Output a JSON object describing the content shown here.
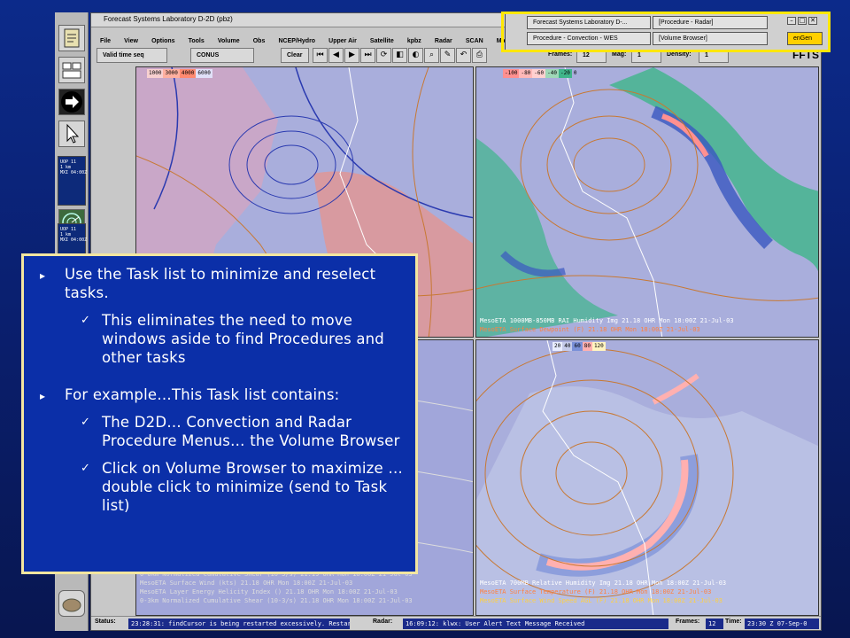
{
  "app": {
    "title": "Forecast Systems Laboratory D-2D (pbz)",
    "menu": [
      "File",
      "View",
      "Options",
      "Tools",
      "Volume",
      "Obs",
      "NCEP/Hydro",
      "Upper Air",
      "Satellite",
      "kpbz",
      "Radar",
      "SCAN",
      "Maps"
    ],
    "toolbar": {
      "time_mode": "Valid time seq",
      "scale": "CONUS",
      "clear": "Clear",
      "frames_label": "Frames:",
      "frames_value": "12",
      "mag_label": "Mag:",
      "mag_value": "1",
      "density_label": "Density:",
      "density_value": "1",
      "logo": "FFTS"
    }
  },
  "tasklist": {
    "items": [
      "Forecast Systems Laboratory D-...",
      "[Procedure - Radar]",
      "Procedure - Convection - WES",
      "[Volume Browser]"
    ],
    "extra_button": "enGen"
  },
  "panels": {
    "top_left_colorbar": [
      "1000",
      "3000",
      "4000",
      "6000"
    ],
    "top_right_colorbar": [
      "-100",
      "-80",
      "-60",
      "-40",
      "-20",
      "0"
    ],
    "bottom_right_colorbar": [
      "20",
      "40",
      "60",
      "80",
      "120"
    ],
    "top_right_legend": [
      "MesoETA 1000MB-850MB RAI Humidity Img  21.18   OHR Mon 18:00Z 21-Jul-03",
      "MesoETA Surface Dewpoint (F)  21.18   OHR Mon 18:00Z 21-Jul-03"
    ],
    "bottom_right_legend": [
      "MesoETA 700MB Relative Humidity Img  21.18   OHR Mon 18:00Z 21-Jul-03",
      "MesoETA Surface Temperature (F)  21.18   OHR Mon 18:00Z 21-Jul-03",
      "MesoETA Surface Wind Speed AGL (F)  21.18   OHR Mon 18:00Z 21-Jul-03"
    ],
    "bottom_left_legend": [
      "0-6km Normalized Cumulative Shear (10-3/s)  21.19   OHR Mon 18:00Z 21-Jul-03",
      "MesoETA Surface Wind (kts)  21.18   OHR Mon 18:00Z 21-Jul-03",
      "MesoETA Layer Energy Helicity Index ()  21.18   OHR Mon 18:00Z 21-Jul-03",
      "0-3km Normalized Cumulative Shear (10-3/s)  21.18   OHR Mon 18:00Z 21-Jul-03"
    ],
    "left_thumb_1": "UOP 11\n1 km\nMXI 04:00Z",
    "left_thumb_2": "UOP 11\n1 km\nMXI 04:00Z"
  },
  "status": {
    "status_label": "Status:",
    "status_text": "23:28:31: findCursor is being restarted excessively. Restarting will be n",
    "radar_label": "Radar:",
    "radar_text": "16:09:12: klwx: User Alert Text Message Received",
    "frames_label": "Frames:",
    "frames_text": "12",
    "time_label": "Time:",
    "time_text": "23:30 Z 07-Sep-0"
  },
  "callout": {
    "b1": "Use the Task list to minimize and reselect tasks.",
    "b1_sub1": "This eliminates the need to move windows aside to find Procedures and other tasks",
    "b2": "For example…This Task list contains:",
    "b2_sub1": "The D2D… Convection and Radar Procedure Menus… the Volume Browser",
    "b2_sub2": "Click on Volume Browser to maximize …double click to minimize (send to Task list)"
  },
  "colors": {
    "slide_bg": "#0c2a8a",
    "callout_bg": "#0b2fa8",
    "callout_border": "#f3e6a0",
    "highlight": "#ffe700",
    "map_land": "#a9aedc",
    "isotherm": "#c87832"
  }
}
